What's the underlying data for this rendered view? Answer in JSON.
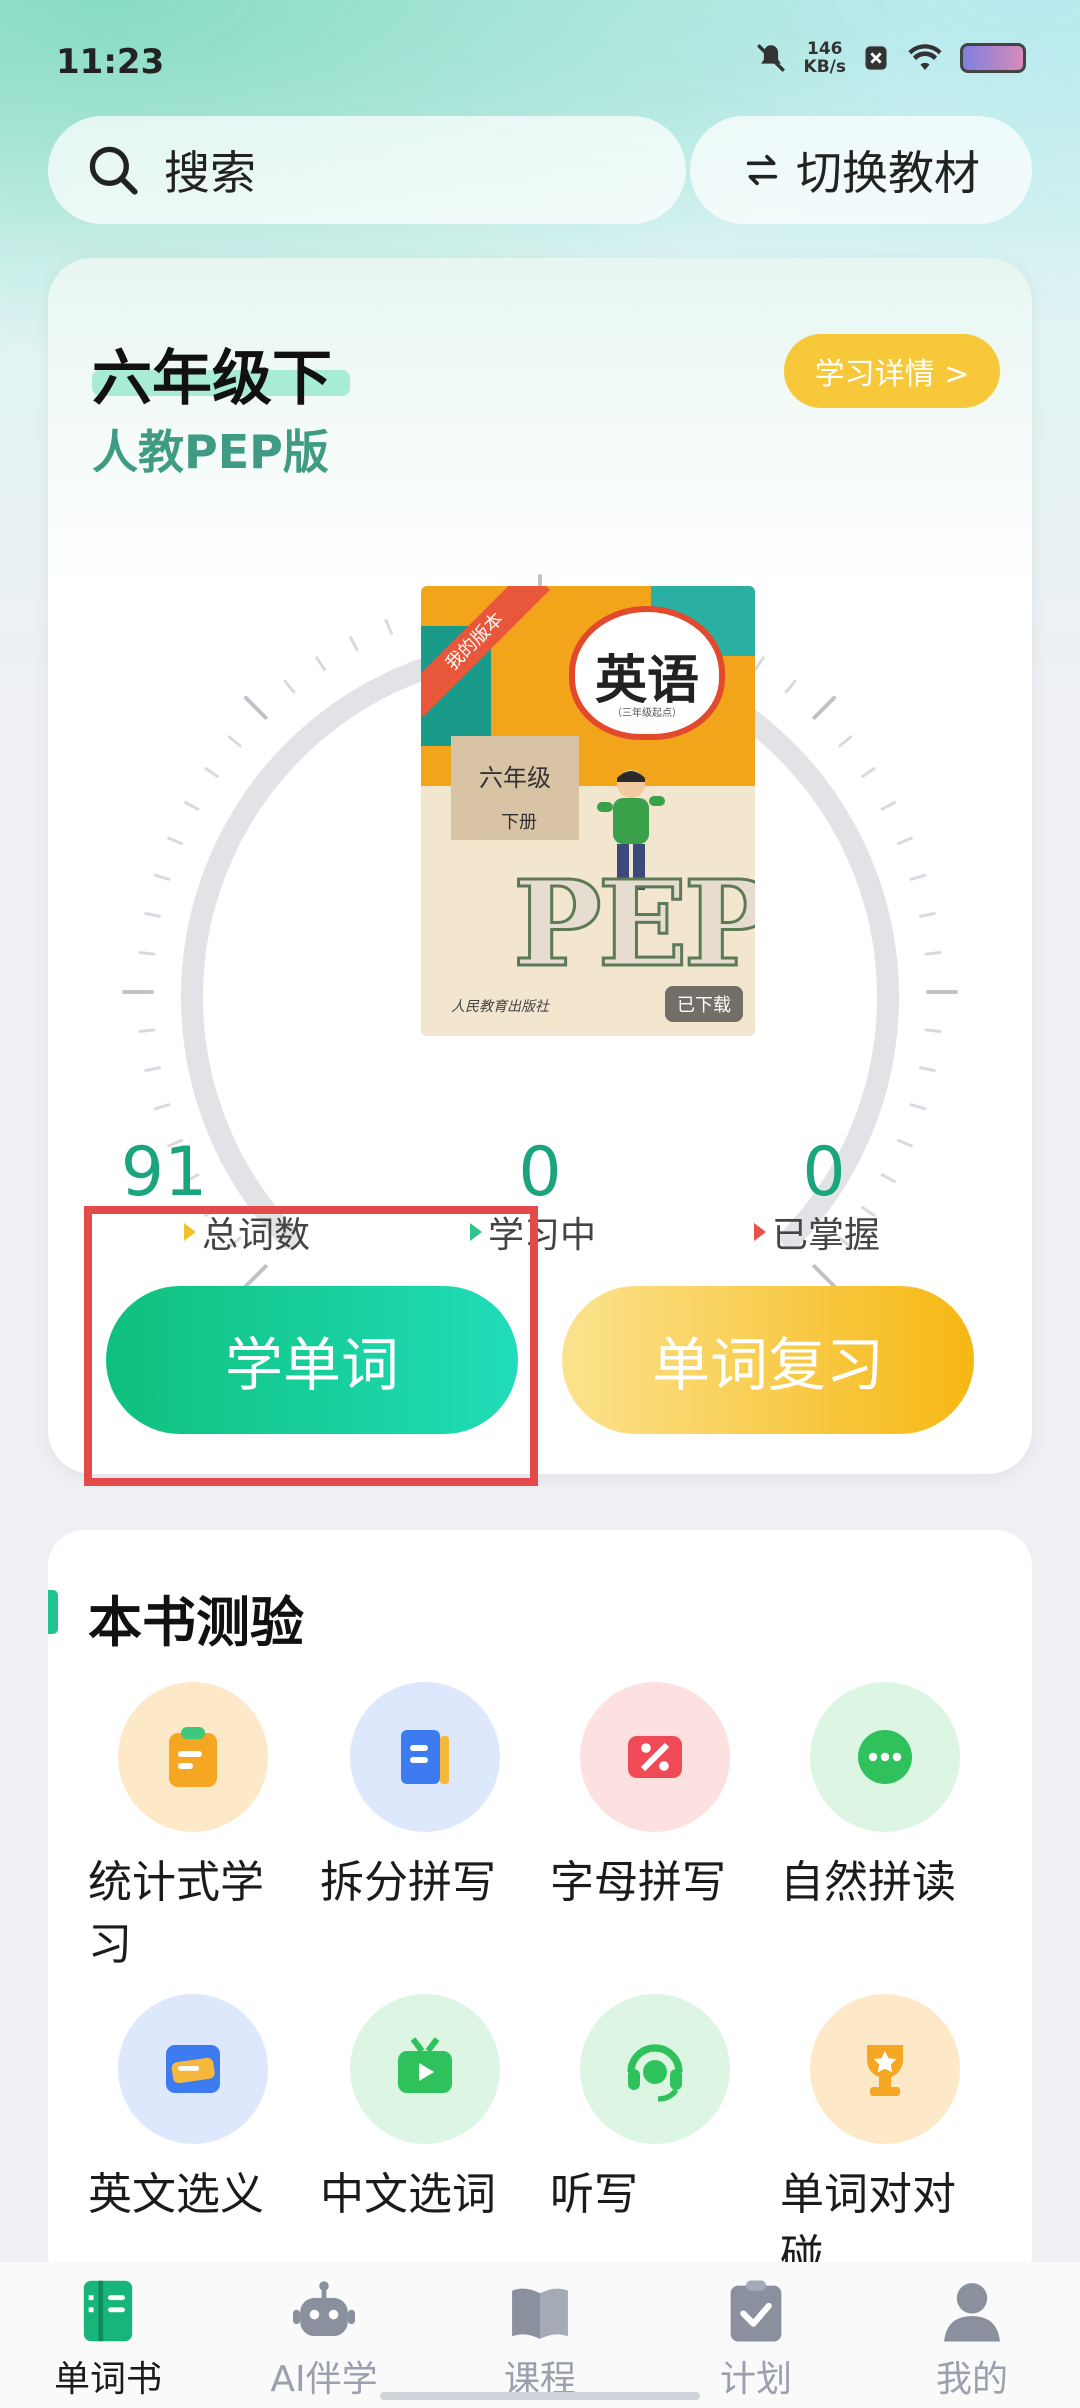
{
  "status_bar": {
    "time": "11:23",
    "speed_value": "146",
    "speed_unit": "KB/s"
  },
  "search": {
    "placeholder": "搜索",
    "icon": "search-icon"
  },
  "switch_book": {
    "label": "切换教材",
    "icon": "swap-icon"
  },
  "book": {
    "grade": "六年级下",
    "edition": "人教PEP版",
    "detail_label": "学习详情 >",
    "cover": {
      "title": "英语",
      "subtitle": "（三年级起点）",
      "ribbon": "我的版本",
      "grade": "六年级",
      "term": "下册",
      "pep": "PEP",
      "publisher": "人民教育出版社",
      "status": "已下载"
    }
  },
  "stats": [
    {
      "value": "91",
      "label": "总词数",
      "marker_color": "#f2c22d"
    },
    {
      "value": "0",
      "label": "学习中",
      "marker_color": "#2fc48c"
    },
    {
      "value": "0",
      "label": "已掌握",
      "marker_color": "#e9504a"
    }
  ],
  "actions": {
    "learn": "学单词",
    "review": "单词复习"
  },
  "quiz": {
    "title": "本书测验",
    "tools": [
      {
        "label": "统计式学\n习",
        "icon": "clipboard-icon",
        "color": "#fde9c7",
        "fg": "#f5a623"
      },
      {
        "label": "拆分拼写",
        "icon": "book-icon",
        "color": "#dde8fd",
        "fg": "#3d7cf0"
      },
      {
        "label": "字母拼写",
        "icon": "percent-icon",
        "color": "#fde0e0",
        "fg": "#ef4a55"
      },
      {
        "label": "自然拼读",
        "icon": "chat-icon",
        "color": "#dcf6e3",
        "fg": "#2fc25c"
      },
      {
        "label": "英文选义",
        "icon": "card-icon",
        "color": "#dde8fd",
        "fg": "#3d7cf0"
      },
      {
        "label": "中文选词",
        "icon": "tv-icon",
        "color": "#dcf6e3",
        "fg": "#2fc25c"
      },
      {
        "label": "听写",
        "icon": "headset-icon",
        "color": "#dcf6e3",
        "fg": "#2fc25c"
      },
      {
        "label": "单词对对\n碰",
        "icon": "trophy-icon",
        "color": "#fde9c7",
        "fg": "#f5a623"
      }
    ]
  },
  "nav": [
    {
      "label": "单词书",
      "icon": "wordbook-icon",
      "active": true
    },
    {
      "label": "AI伴学",
      "icon": "robot-icon",
      "active": false
    },
    {
      "label": "课程",
      "icon": "open-book-icon",
      "active": false
    },
    {
      "label": "计划",
      "icon": "checklist-icon",
      "active": false
    },
    {
      "label": "我的",
      "icon": "profile-icon",
      "active": false
    }
  ],
  "colors": {
    "accent_green": "#1ba57f",
    "button_green": "#12c58a",
    "button_yellow": "#f6b712",
    "highlight_red": "#e54a4a"
  }
}
